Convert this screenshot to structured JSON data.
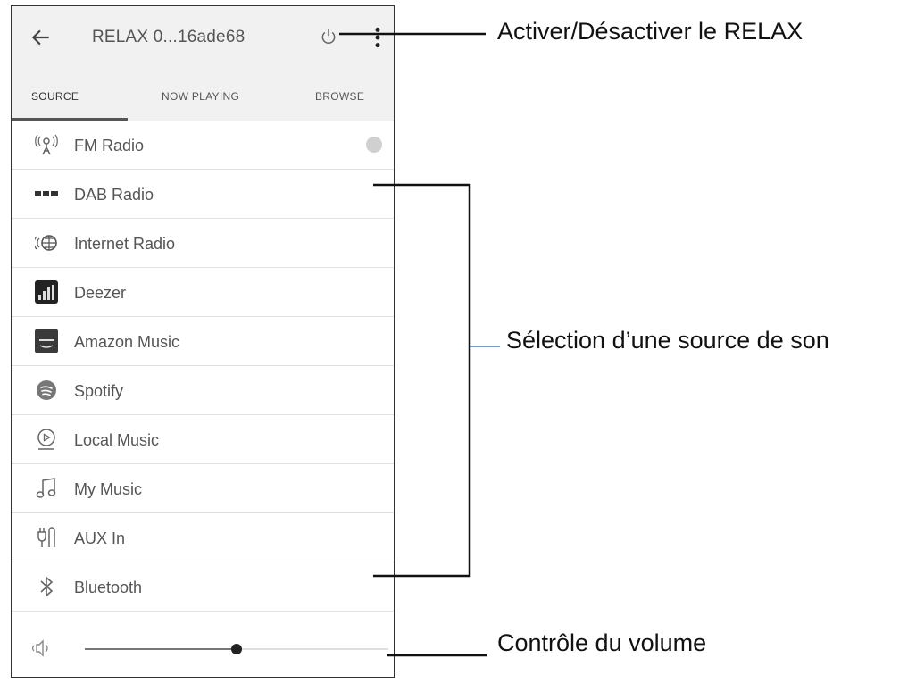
{
  "header": {
    "title": "RELAX 0...16ade68"
  },
  "tabs": [
    {
      "label": "SOURCE",
      "active": true
    },
    {
      "label": "NOW PLAYING",
      "active": false
    },
    {
      "label": "BROWSE",
      "active": false
    }
  ],
  "sources": [
    {
      "label": "FM Radio",
      "icon": "fm-radio-icon",
      "selected": true
    },
    {
      "label": "DAB Radio",
      "icon": "dab-icon"
    },
    {
      "label": "Internet Radio",
      "icon": "internet-radio-icon"
    },
    {
      "label": "Deezer",
      "icon": "deezer-icon"
    },
    {
      "label": "Amazon Music",
      "icon": "amazon-music-icon"
    },
    {
      "label": "Spotify",
      "icon": "spotify-icon"
    },
    {
      "label": "Local Music",
      "icon": "local-music-icon"
    },
    {
      "label": "My Music",
      "icon": "music-note-icon"
    },
    {
      "label": "AUX In",
      "icon": "aux-icon"
    },
    {
      "label": "Bluetooth",
      "icon": "bluetooth-icon"
    }
  ],
  "volume": {
    "level_fraction": 0.5
  },
  "annotations": {
    "power": "Activer/Désactiver le RELAX",
    "source": "Sélection d’une source de son",
    "volume": "Contrôle du volume"
  },
  "colors": {
    "appbar_bg": "#f1f1f1",
    "text": "#555555",
    "tab_indicator": "#555555"
  }
}
